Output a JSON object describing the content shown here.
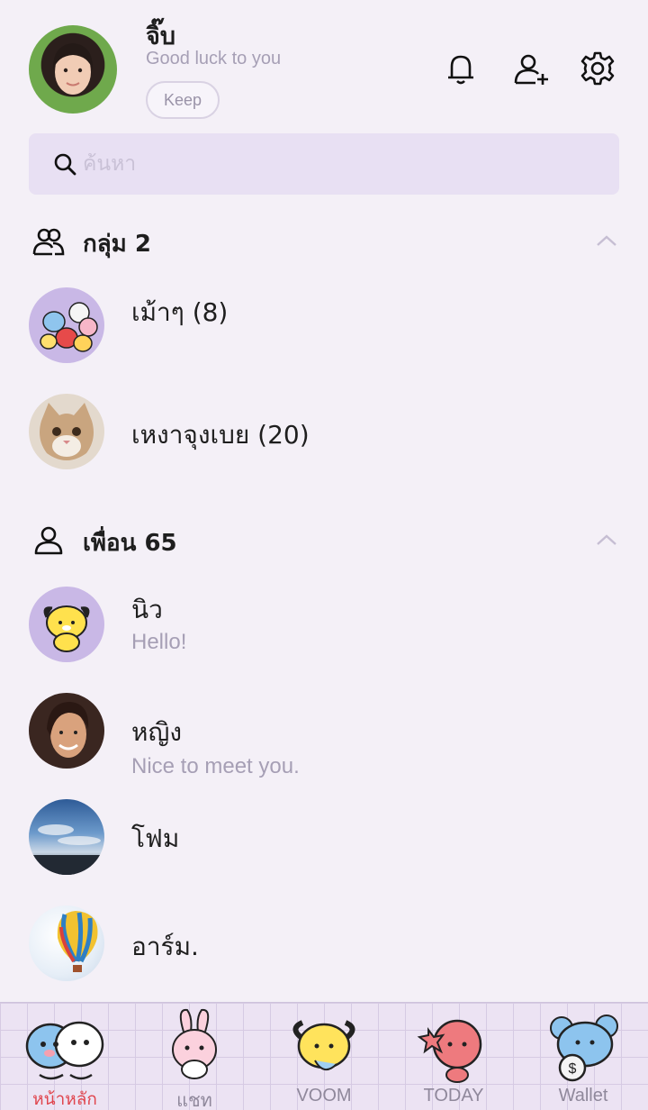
{
  "profile": {
    "name": "จิ๊บ",
    "status": "Good luck to you",
    "keep_label": "Keep"
  },
  "header_icons": [
    "bell-icon",
    "add-friend-icon",
    "gear-icon"
  ],
  "search": {
    "placeholder": "ค้นหา"
  },
  "groups": {
    "title": "กลุ่ม 2",
    "items": [
      {
        "name": "เม้าๆ (8)"
      },
      {
        "name": "เหงาจุงเบย (20)"
      }
    ]
  },
  "friends": {
    "title": "เพื่อน 65",
    "items": [
      {
        "name": "นิว",
        "message": "Hello!"
      },
      {
        "name": "หญิง",
        "message": "Nice to meet you."
      },
      {
        "name": "โฟม",
        "message": ""
      },
      {
        "name": "อาร์ม.",
        "message": ""
      }
    ]
  },
  "nav": {
    "items": [
      {
        "label": "หน้าหลัก",
        "active": true
      },
      {
        "label": "แชท",
        "active": false
      },
      {
        "label": "VOOM",
        "active": false
      },
      {
        "label": "TODAY",
        "active": false
      },
      {
        "label": "Wallet",
        "active": false
      }
    ]
  },
  "colors": {
    "background": "#f4f0f7",
    "search_bg": "#e8e0f3",
    "muted_text": "#a69fb5",
    "active_nav": "#e0454d"
  }
}
